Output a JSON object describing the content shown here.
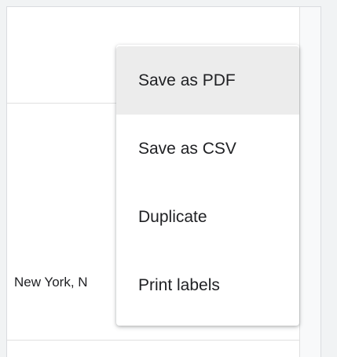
{
  "table": {
    "cell_text": "New York, N"
  },
  "menu": {
    "items": [
      {
        "label": "Save as PDF"
      },
      {
        "label": "Save as CSV"
      },
      {
        "label": "Duplicate"
      },
      {
        "label": "Print labels"
      }
    ]
  }
}
